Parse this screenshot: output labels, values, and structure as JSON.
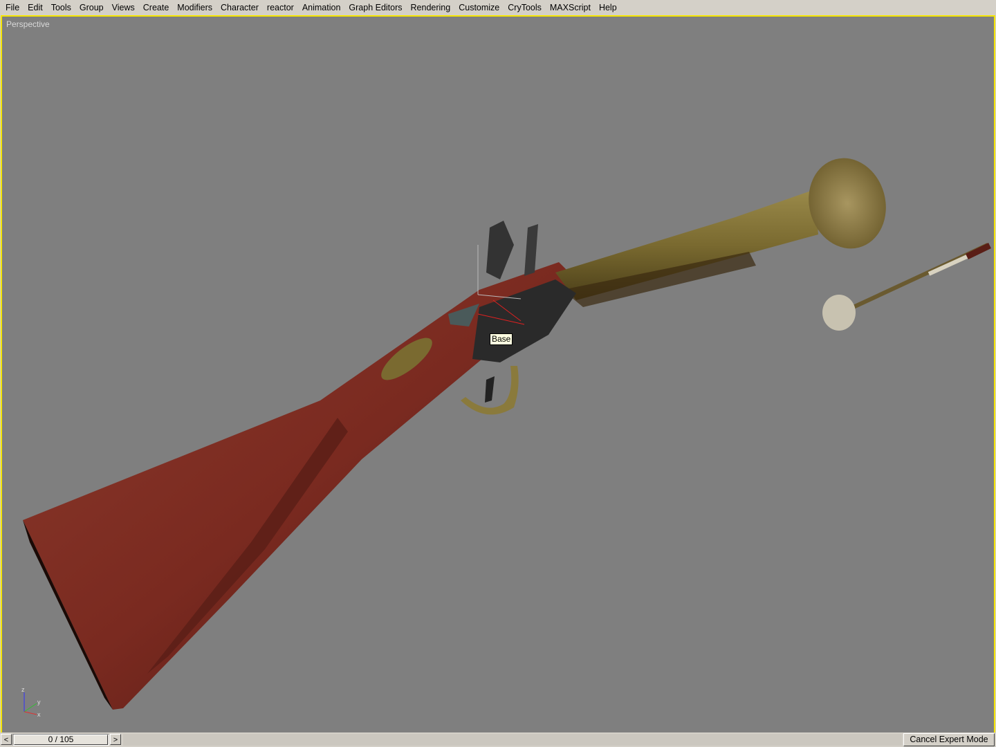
{
  "menu": [
    "File",
    "Edit",
    "Tools",
    "Group",
    "Views",
    "Create",
    "Modifiers",
    "Character",
    "reactor",
    "Animation",
    "Graph Editors",
    "Rendering",
    "Customize",
    "CryTools",
    "MAXScript",
    "Help"
  ],
  "viewport": {
    "label": "Perspective",
    "tooltip": "Base",
    "axes": {
      "z": "z",
      "y": "y",
      "x": "x"
    }
  },
  "timeline": {
    "prev_label": "<",
    "next_label": ">",
    "frame_text": "0 / 105"
  },
  "expert_button": "Cancel Expert Mode",
  "colors": {
    "viewport_bg": "#7f7f7f",
    "viewport_border": "#f5e600",
    "wood": "#7a2a20",
    "brass": "#8a7a3c"
  }
}
